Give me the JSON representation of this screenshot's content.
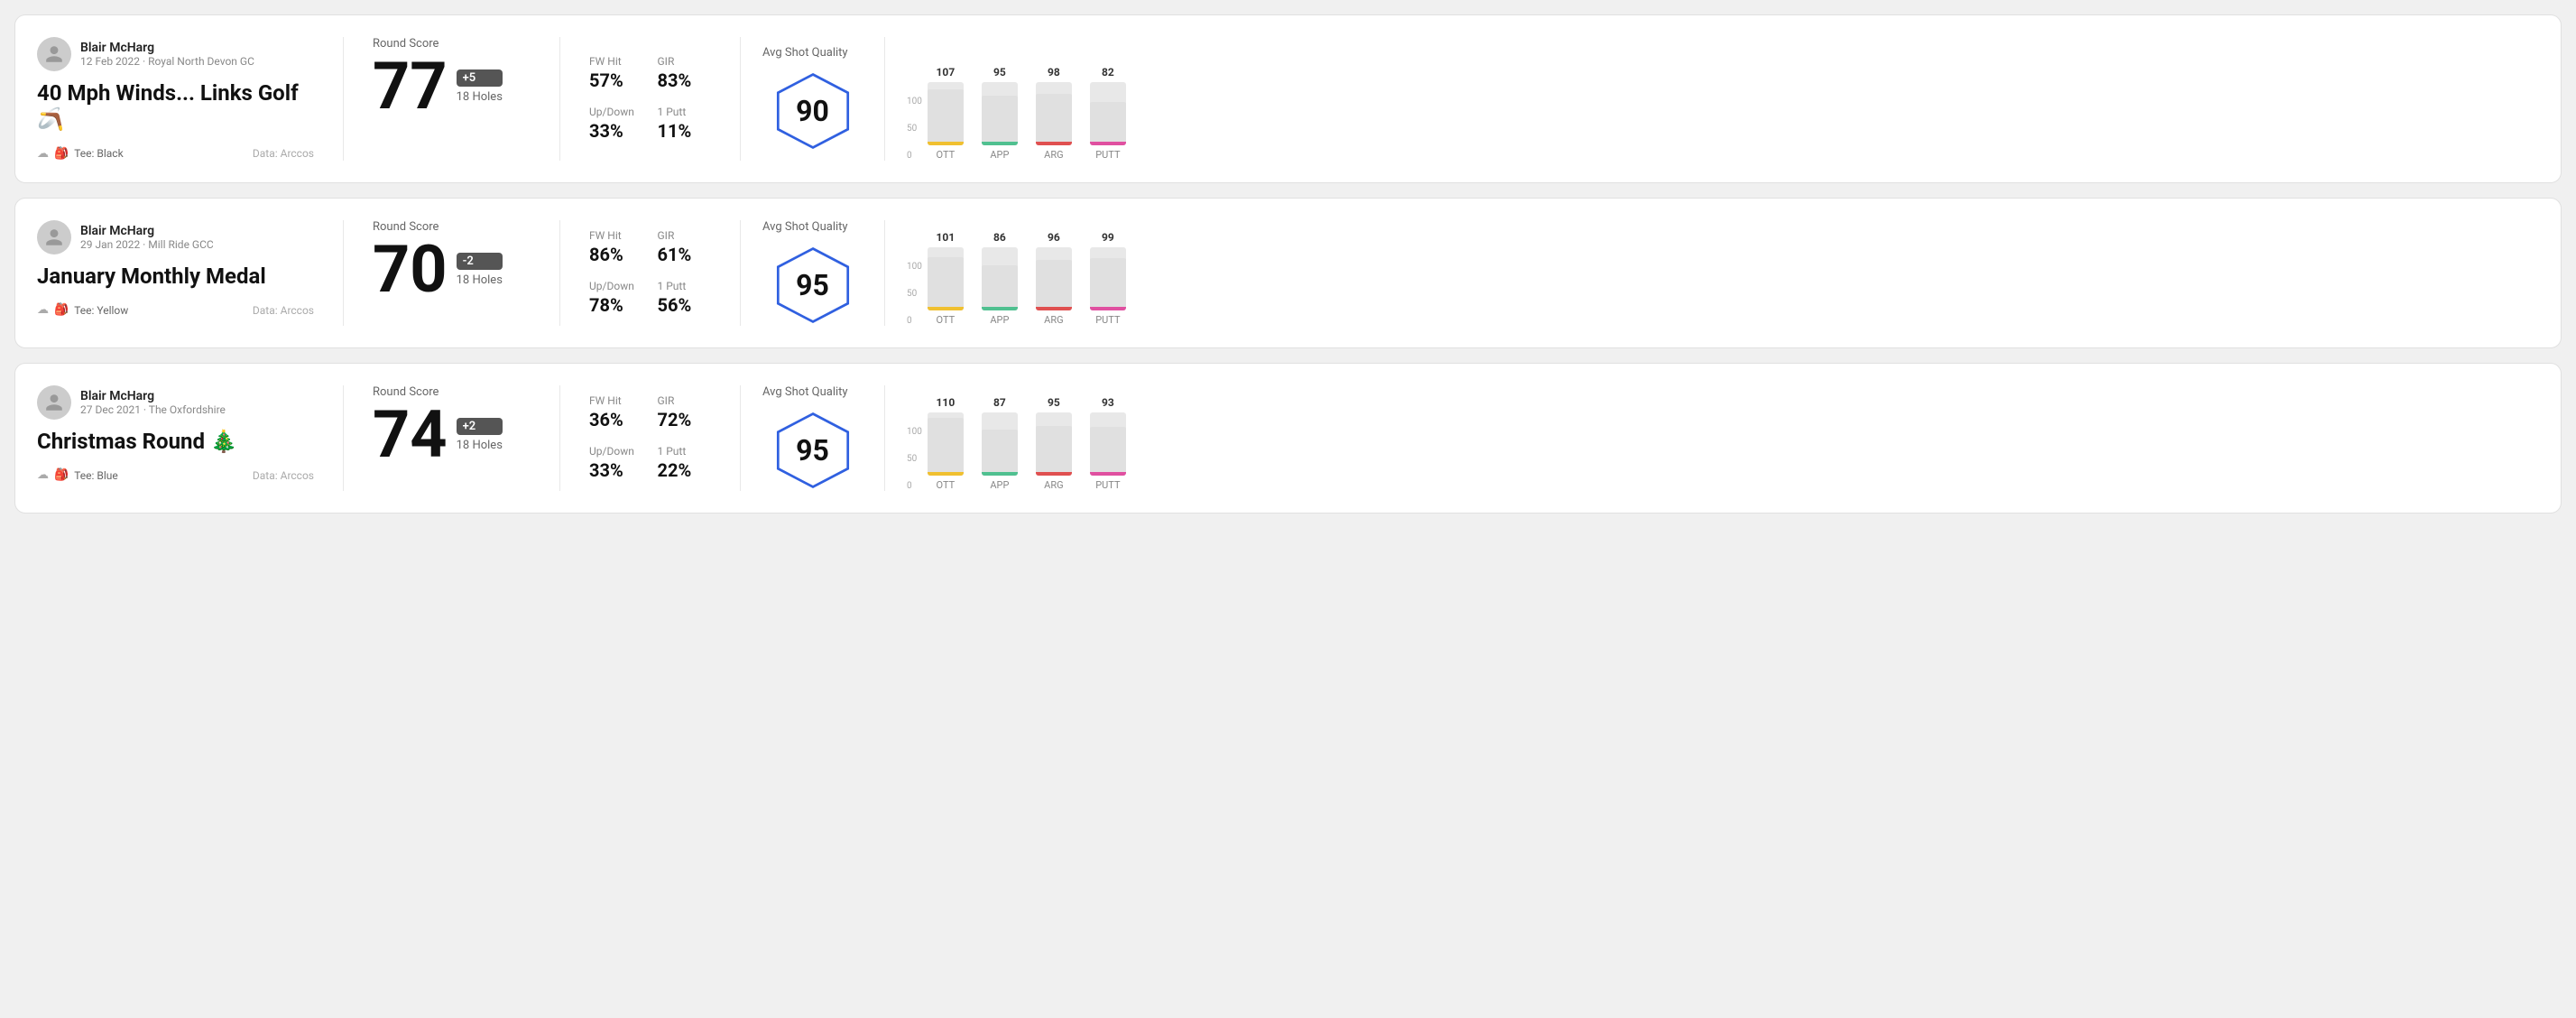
{
  "rounds": [
    {
      "id": "round-1",
      "user": {
        "name": "Blair McHarg",
        "date": "12 Feb 2022",
        "course": "Royal North Devon GC"
      },
      "title": "40 Mph Winds... Links Golf 🪃",
      "tee": "Black",
      "data_source": "Data: Arccos",
      "score": "77",
      "score_diff": "+5",
      "holes": "18 Holes",
      "fw_hit_label": "FW Hit",
      "fw_hit": "57%",
      "gir_label": "GIR",
      "gir": "83%",
      "updown_label": "Up/Down",
      "updown": "33%",
      "oneputt_label": "1 Putt",
      "oneputt": "11%",
      "quality_label": "Avg Shot Quality",
      "quality_score": "90",
      "bars": [
        {
          "label": "OTT",
          "value": 107,
          "color": "#f0c030"
        },
        {
          "label": "APP",
          "value": 95,
          "color": "#50c090"
        },
        {
          "label": "ARG",
          "value": 98,
          "color": "#e05050"
        },
        {
          "label": "PUTT",
          "value": 82,
          "color": "#e050a0"
        }
      ]
    },
    {
      "id": "round-2",
      "user": {
        "name": "Blair McHarg",
        "date": "29 Jan 2022",
        "course": "Mill Ride GCC"
      },
      "title": "January Monthly Medal",
      "tee": "Yellow",
      "data_source": "Data: Arccos",
      "score": "70",
      "score_diff": "-2",
      "holes": "18 Holes",
      "fw_hit_label": "FW Hit",
      "fw_hit": "86%",
      "gir_label": "GIR",
      "gir": "61%",
      "updown_label": "Up/Down",
      "updown": "78%",
      "oneputt_label": "1 Putt",
      "oneputt": "56%",
      "quality_label": "Avg Shot Quality",
      "quality_score": "95",
      "bars": [
        {
          "label": "OTT",
          "value": 101,
          "color": "#f0c030"
        },
        {
          "label": "APP",
          "value": 86,
          "color": "#50c090"
        },
        {
          "label": "ARG",
          "value": 96,
          "color": "#e05050"
        },
        {
          "label": "PUTT",
          "value": 99,
          "color": "#e050a0"
        }
      ]
    },
    {
      "id": "round-3",
      "user": {
        "name": "Blair McHarg",
        "date": "27 Dec 2021",
        "course": "The Oxfordshire"
      },
      "title": "Christmas Round 🎄",
      "tee": "Blue",
      "data_source": "Data: Arccos",
      "score": "74",
      "score_diff": "+2",
      "holes": "18 Holes",
      "fw_hit_label": "FW Hit",
      "fw_hit": "36%",
      "gir_label": "GIR",
      "gir": "72%",
      "updown_label": "Up/Down",
      "updown": "33%",
      "oneputt_label": "1 Putt",
      "oneputt": "22%",
      "quality_label": "Avg Shot Quality",
      "quality_score": "95",
      "bars": [
        {
          "label": "OTT",
          "value": 110,
          "color": "#f0c030"
        },
        {
          "label": "APP",
          "value": 87,
          "color": "#50c090"
        },
        {
          "label": "ARG",
          "value": 95,
          "color": "#e05050"
        },
        {
          "label": "PUTT",
          "value": 93,
          "color": "#e050a0"
        }
      ]
    }
  ],
  "labels": {
    "round_score": "Round Score",
    "avg_shot_quality": "Avg Shot Quality",
    "data_arccos": "Data: Arccos"
  }
}
